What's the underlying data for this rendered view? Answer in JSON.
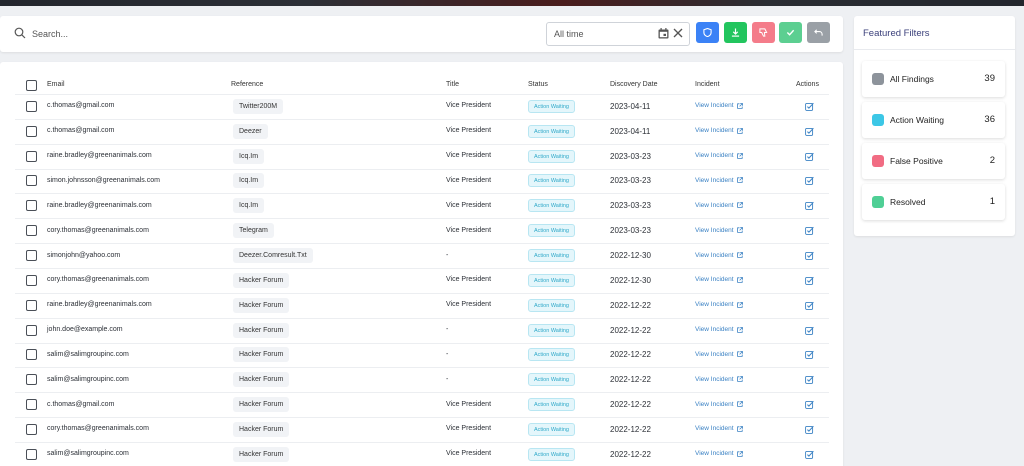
{
  "search": {
    "placeholder": "Search..."
  },
  "date_filter": {
    "value": "All time"
  },
  "toolbar": {
    "buttons": [
      {
        "name": "shield-button",
        "color": "#3b82f6"
      },
      {
        "name": "download-button",
        "color": "#22c55e"
      },
      {
        "name": "dislike-button",
        "color": "#f47c8a"
      },
      {
        "name": "resolve-button",
        "color": "#5ccf91"
      },
      {
        "name": "undo-button",
        "color": "#9aa0a6"
      }
    ]
  },
  "table": {
    "headers": {
      "email": "Email",
      "reference": "Reference",
      "title": "Title",
      "status": "Status",
      "discovery_date": "Discovery Date",
      "incident": "Incident",
      "actions": "Actions"
    },
    "rows": [
      {
        "email": "c.thomas@gmail.com",
        "reference": "Twitter200M",
        "title": "Vice President",
        "status": "Action Waiting",
        "date": "2023-04-11",
        "incident": "View Incident"
      },
      {
        "email": "c.thomas@gmail.com",
        "reference": "Deezer",
        "title": "Vice President",
        "status": "Action Waiting",
        "date": "2023-04-11",
        "incident": "View Incident"
      },
      {
        "email": "raine.bradley@greenanimals.com",
        "reference": "Icq.Im",
        "title": "Vice President",
        "status": "Action Waiting",
        "date": "2023-03-23",
        "incident": "View Incident"
      },
      {
        "email": "simon.johnsson@greenanimals.com",
        "reference": "Icq.Im",
        "title": "Vice President",
        "status": "Action Waiting",
        "date": "2023-03-23",
        "incident": "View Incident"
      },
      {
        "email": "raine.bradley@greenanimals.com",
        "reference": "Icq.Im",
        "title": "Vice President",
        "status": "Action Waiting",
        "date": "2023-03-23",
        "incident": "View Incident"
      },
      {
        "email": "cory.thomas@greenanimals.com",
        "reference": "Telegram",
        "title": "Vice President",
        "status": "Action Waiting",
        "date": "2023-03-23",
        "incident": "View Incident"
      },
      {
        "email": "simonjohn@yahoo.com",
        "reference": "Deezer.Comresult.Txt",
        "title": "-",
        "status": "Action Waiting",
        "date": "2022-12-30",
        "incident": "View Incident"
      },
      {
        "email": "cory.thomas@greenanimals.com",
        "reference": "Hacker Forum",
        "title": "Vice President",
        "status": "Action Waiting",
        "date": "2022-12-30",
        "incident": "View Incident"
      },
      {
        "email": "raine.bradley@greenanimals.com",
        "reference": "Hacker Forum",
        "title": "Vice President",
        "status": "Action Waiting",
        "date": "2022-12-22",
        "incident": "View Incident"
      },
      {
        "email": "john.doe@example.com",
        "reference": "Hacker Forum",
        "title": "-",
        "status": "Action Waiting",
        "date": "2022-12-22",
        "incident": "View Incident"
      },
      {
        "email": "salim@salimgroupinc.com",
        "reference": "Hacker Forum",
        "title": "-",
        "status": "Action Waiting",
        "date": "2022-12-22",
        "incident": "View Incident"
      },
      {
        "email": "salim@salimgroupinc.com",
        "reference": "Hacker Forum",
        "title": "-",
        "status": "Action Waiting",
        "date": "2022-12-22",
        "incident": "View Incident"
      },
      {
        "email": "c.thomas@gmail.com",
        "reference": "Hacker Forum",
        "title": "Vice President",
        "status": "Action Waiting",
        "date": "2022-12-22",
        "incident": "View Incident"
      },
      {
        "email": "cory.thomas@greenanimals.com",
        "reference": "Hacker Forum",
        "title": "Vice President",
        "status": "Action Waiting",
        "date": "2022-12-22",
        "incident": "View Incident"
      },
      {
        "email": "salim@salimgroupinc.com",
        "reference": "Hacker Forum",
        "title": "Vice President",
        "status": "Action Waiting",
        "date": "2022-12-22",
        "incident": "View Incident"
      }
    ]
  },
  "featured_filters": {
    "title": "Featured Filters",
    "items": [
      {
        "label": "All Findings",
        "count": "39",
        "color": "#8d939b"
      },
      {
        "label": "Action Waiting",
        "count": "36",
        "color": "#3cc7e6"
      },
      {
        "label": "False Positive",
        "count": "2",
        "color": "#f16c83"
      },
      {
        "label": "Resolved",
        "count": "1",
        "color": "#4fcf95"
      }
    ]
  },
  "colors": {
    "accent": "#3b82c4",
    "status_badge": "#2fa9c9",
    "background": "#eef0f3"
  }
}
